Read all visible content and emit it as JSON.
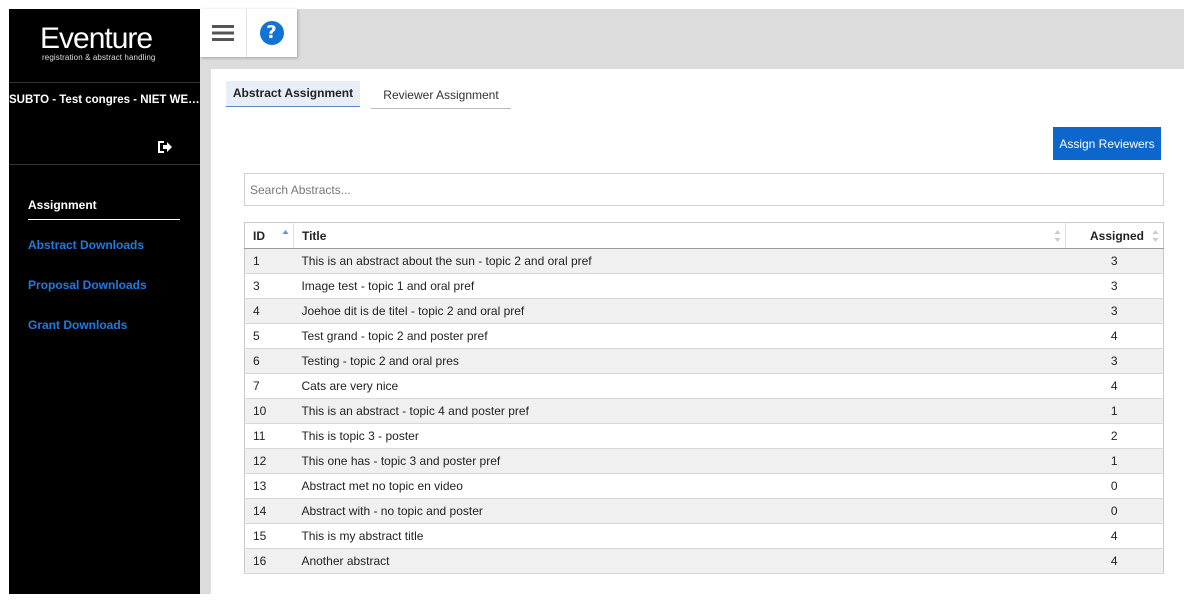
{
  "brand": {
    "name": "Eventure",
    "tagline": "registration & abstract handling"
  },
  "sidebar": {
    "congress": "SUBTO - Test congres - NIET WEGGOOIEN",
    "logout_icon": "sign-out-icon",
    "items": [
      {
        "label": "Assignment",
        "active": true
      },
      {
        "label": "Abstract Downloads",
        "active": false
      },
      {
        "label": "Proposal Downloads",
        "active": false
      },
      {
        "label": "Grant Downloads",
        "active": false
      }
    ]
  },
  "toolbar": {
    "menu_icon": "hamburger-icon",
    "help_icon": "question-circle-icon",
    "help_glyph": "?"
  },
  "tabs": [
    {
      "label": "Abstract Assignment",
      "active": true
    },
    {
      "label": "Reviewer Assignment",
      "active": false
    }
  ],
  "actions": {
    "assign_reviewers": "Assign Reviewers"
  },
  "search": {
    "placeholder": "Search Abstracts...",
    "value": ""
  },
  "table": {
    "headers": {
      "id": "ID",
      "title": "Title",
      "assigned": "Assigned"
    },
    "rows": [
      {
        "id": "1",
        "title": "This is an abstract about the sun - topic 2 and oral pref",
        "assigned": "3"
      },
      {
        "id": "3",
        "title": "Image test - topic 1 and oral pref",
        "assigned": "3"
      },
      {
        "id": "4",
        "title": "Joehoe dit is de titel - topic 2 and oral pref",
        "assigned": "3"
      },
      {
        "id": "5",
        "title": "Test grand - topic 2 and poster pref",
        "assigned": "4"
      },
      {
        "id": "6",
        "title": "Testing - topic 2 and oral pres",
        "assigned": "3"
      },
      {
        "id": "7",
        "title": "Cats are very nice",
        "assigned": "4"
      },
      {
        "id": "10",
        "title": "This is an abstract - topic 4 and poster pref",
        "assigned": "1"
      },
      {
        "id": "11",
        "title": "This is topic 3 - poster",
        "assigned": "2"
      },
      {
        "id": "12",
        "title": "This one has - topic 3 and poster pref",
        "assigned": "1"
      },
      {
        "id": "13",
        "title": "Abstract met no topic en video",
        "assigned": "0"
      },
      {
        "id": "14",
        "title": "Abstract with - no topic and poster",
        "assigned": "0"
      },
      {
        "id": "15",
        "title": "This is my abstract title",
        "assigned": "4"
      },
      {
        "id": "16",
        "title": "Another abstract",
        "assigned": "4"
      }
    ]
  },
  "colors": {
    "accent": "#0c66cc",
    "nav_link": "#1e7be0",
    "sidebar_bg": "#000000",
    "frame_bg": "#dcdcdc"
  }
}
